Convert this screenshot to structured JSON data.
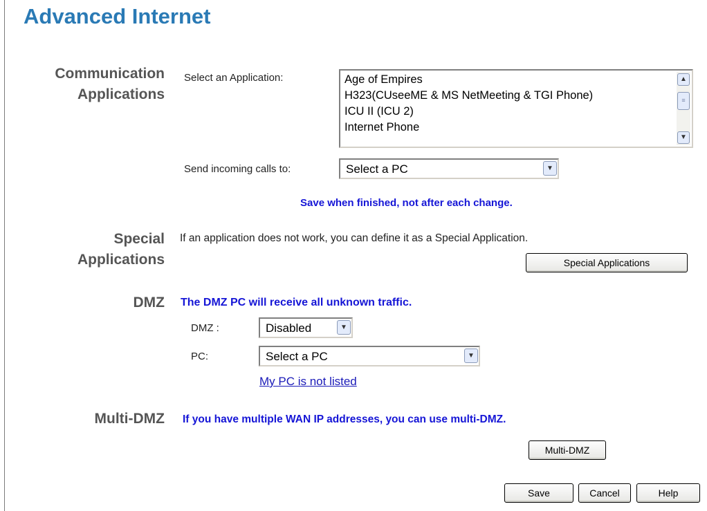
{
  "page": {
    "title": "Advanced Internet"
  },
  "communication": {
    "heading_line1": "Communication",
    "heading_line2": "Applications",
    "select_label": "Select an Application:",
    "applications": [
      "Age of Empires",
      "H323(CUseeME & MS NetMeeting & TGI Phone)",
      "ICU II (ICU 2)",
      "Internet Phone"
    ],
    "incoming_label": "Send incoming calls to:",
    "incoming_value": "Select a PC",
    "save_note": "Save when finished, not after each change."
  },
  "special": {
    "heading_line1": "Special",
    "heading_line2": "Applications",
    "description": "If an application does not work, you can define it as a Special Application.",
    "button_label": "Special Applications"
  },
  "dmz": {
    "heading": "DMZ",
    "note": "The DMZ PC will receive all unknown traffic.",
    "dmz_label": "DMZ :",
    "dmz_value": "Disabled",
    "pc_label": "PC:",
    "pc_value": "Select a PC",
    "link_text": "My PC is not listed"
  },
  "multi_dmz": {
    "heading": "Multi-DMZ",
    "note": "If you have multiple WAN IP addresses, you can use multi-DMZ.",
    "button_label": "Multi-DMZ"
  },
  "footer": {
    "save_label": "Save",
    "cancel_label": "Cancel",
    "help_label": "Help"
  },
  "colors": {
    "title": "#2a7ab5",
    "note": "#1515d6",
    "section_heading": "#555555",
    "link": "#1a1ab8"
  },
  "icons": {
    "scroll_up": "scroll-up-arrow-icon",
    "scroll_down": "scroll-down-arrow-icon",
    "dropdown": "chevron-down-icon"
  }
}
